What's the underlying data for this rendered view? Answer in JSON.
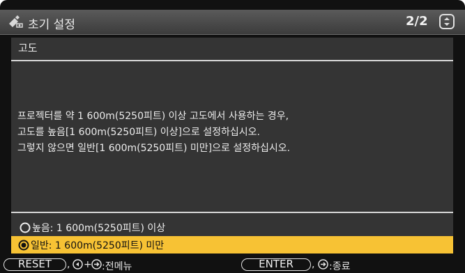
{
  "titlebar": {
    "icon": "projector-wrench-icon",
    "title": "초기 설정",
    "page_indicator": "2/2",
    "scroll_icon": "scroll-updown-icon"
  },
  "panel": {
    "section_title": "고도",
    "description": [
      "프로젝터를 약 1 600m(5250피트) 이상 고도에서 사용하는 경우,",
      "고도를 높음[1 600m(5250피트) 이상]으로 설정하십시오.",
      "그렇지 않으면 일반[1 600m(5250피트) 미만]으로 설정하십시오."
    ],
    "options": [
      {
        "label": "높음: 1 600m(5250피트) 이상",
        "selected": false
      },
      {
        "label": "일반: 1 600m(5250피트) 미만",
        "selected": true
      }
    ]
  },
  "footer": {
    "reset_label": "RESET",
    "comma1": ",",
    "plus": "+",
    "back_menu_label": ":전메뉴",
    "enter_label": "ENTER",
    "comma2": ",",
    "exit_label": ":종료"
  },
  "colors": {
    "highlight": "#f7c234",
    "panel_bg": "#343434",
    "title_bg": "#4a4a4a"
  }
}
